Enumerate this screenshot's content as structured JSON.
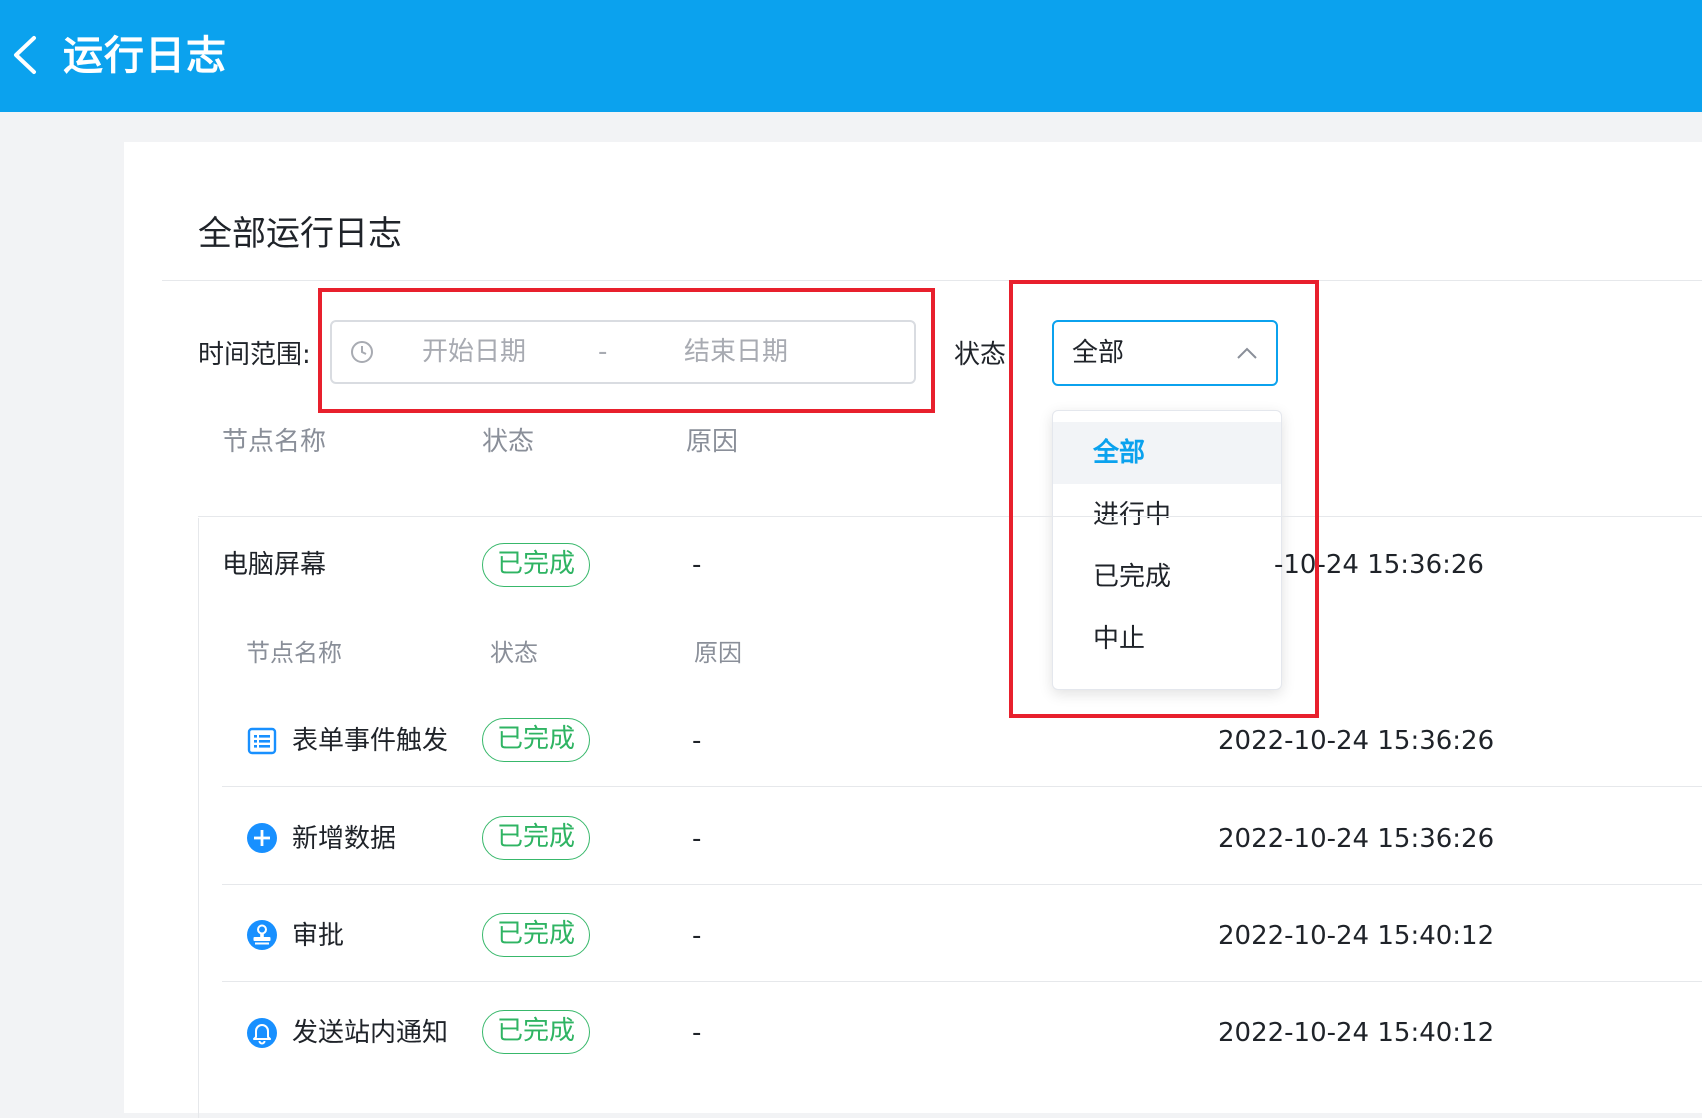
{
  "header": {
    "title": "运行日志"
  },
  "page": {
    "title": "全部运行日志"
  },
  "filters": {
    "time_label": "时间范围:",
    "start_placeholder": "开始日期",
    "separator": "-",
    "end_placeholder": "结束日期",
    "status_label": "状态:",
    "status_value": "全部",
    "status_options": [
      "全部",
      "进行中",
      "已完成",
      "中止"
    ]
  },
  "table": {
    "headers": [
      "节点名称",
      "状态",
      "原因"
    ],
    "parent_row": {
      "name": "电脑屏幕",
      "status": "已完成",
      "reason": "-",
      "time": "2022-10-24 15:36:26",
      "time_visible": "-10-24 15:36:26"
    },
    "sub_headers": [
      "节点名称",
      "状态",
      "原因"
    ],
    "rows": [
      {
        "icon": "form-list-icon",
        "name": "表单事件触发",
        "status": "已完成",
        "reason": "-",
        "time": "2022-10-24 15:36:26"
      },
      {
        "icon": "plus-circle-icon",
        "name": "新增数据",
        "status": "已完成",
        "reason": "-",
        "time": "2022-10-24 15:36:26"
      },
      {
        "icon": "stamp-approve-icon",
        "name": "审批",
        "status": "已完成",
        "reason": "-",
        "time": "2022-10-24 15:40:12"
      },
      {
        "icon": "bell-notify-icon",
        "name": "发送站内通知",
        "status": "已完成",
        "reason": "-",
        "time": "2022-10-24 15:40:12"
      }
    ]
  },
  "colors": {
    "header_bg": "#0ba2ee",
    "success": "#2fb463",
    "highlight": "#e8202d"
  }
}
